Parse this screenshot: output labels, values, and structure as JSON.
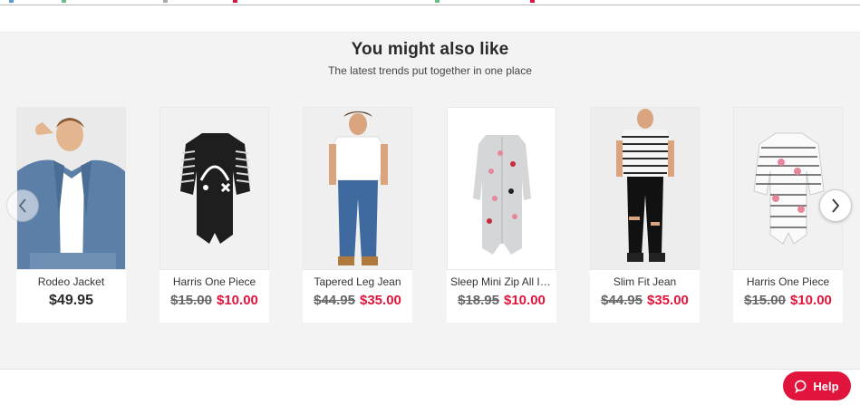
{
  "section": {
    "title": "You might also like",
    "subtitle": "The latest trends put together in one place"
  },
  "carousel": {
    "prev_icon": "chevron-left-icon",
    "next_icon": "chevron-right-icon",
    "products": [
      {
        "name": "Rodeo Jacket",
        "price": "$49.95",
        "was": "",
        "now": ""
      },
      {
        "name": "Harris One Piece",
        "price": "",
        "was": "$15.00",
        "now": "$10.00"
      },
      {
        "name": "Tapered Leg Jean",
        "price": "",
        "was": "$44.95",
        "now": "$35.00"
      },
      {
        "name": "Sleep Mini Zip All In ...",
        "price": "",
        "was": "$18.95",
        "now": "$10.00"
      },
      {
        "name": "Slim Fit Jean",
        "price": "",
        "was": "$44.95",
        "now": "$35.00"
      },
      {
        "name": "Harris One Piece",
        "price": "",
        "was": "$15.00",
        "now": "$10.00"
      }
    ]
  },
  "help": {
    "label": "Help",
    "icon": "chat-bubble-icon"
  },
  "colors": {
    "accent": "#e0143c",
    "background": "#f3f3f3"
  }
}
